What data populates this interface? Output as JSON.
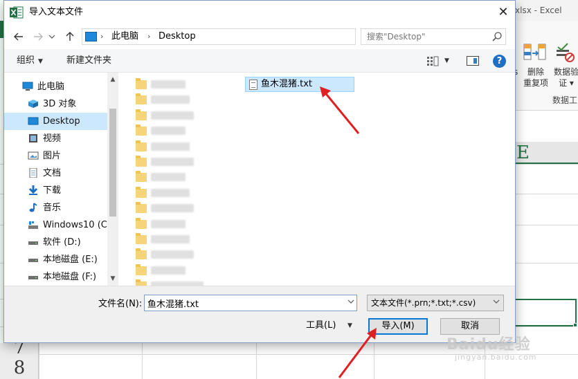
{
  "excel": {
    "title_fragment": "xlsx - Excel",
    "ribbon": {
      "remove_duplicates_line1": "删除",
      "remove_duplicates_line2": "重复项",
      "data_validation_line1": "数据验",
      "data_validation_line2": "证 ▾",
      "group_label": "数据工",
      "partial_label": "s"
    },
    "column_header": "E",
    "row_numbers": [
      "7",
      "8"
    ],
    "colors": {
      "accent": "#217346"
    }
  },
  "dialog": {
    "title": "导入文本文件",
    "close_glyph": "✕",
    "address": {
      "crumbs": [
        "此电脑",
        "Desktop"
      ],
      "separator": "›"
    },
    "search": {
      "placeholder": "搜索\"Desktop\""
    },
    "toolbar": {
      "organize_label": "组织",
      "new_folder_label": "新建文件夹",
      "help_glyph": "?"
    },
    "nav_items": [
      {
        "label": "此电脑",
        "icon": "computer-icon"
      },
      {
        "label": "3D 对象",
        "icon": "3d-objects-icon"
      },
      {
        "label": "Desktop",
        "icon": "desktop-icon",
        "selected": true
      },
      {
        "label": "视频",
        "icon": "video-icon"
      },
      {
        "label": "图片",
        "icon": "pictures-icon"
      },
      {
        "label": "文档",
        "icon": "documents-icon"
      },
      {
        "label": "下载",
        "icon": "download-icon"
      },
      {
        "label": "音乐",
        "icon": "music-icon"
      },
      {
        "label": "Windows10 (C:",
        "icon": "windows-drive-icon"
      },
      {
        "label": "软件 (D:)",
        "icon": "drive-icon"
      },
      {
        "label": "本地磁盘 (E:)",
        "icon": "drive-icon"
      },
      {
        "label": "本地磁盘 (F:)",
        "icon": "drive-icon"
      }
    ],
    "files": {
      "selected_file": "鱼木混猪.txt",
      "blurred_folder_count": 14
    },
    "bottom": {
      "filename_label": "文件名(N):",
      "filename_value": "鱼木混猪.txt",
      "filetype_value": "文本文件(*.prn;*.txt;*.csv)",
      "tools_label": "工具(L)",
      "import_label": "导入(M)",
      "cancel_label": "取消"
    }
  },
  "watermark": {
    "main": "Baidu经验",
    "sub": "jingyan.baidu.com"
  },
  "annotation_color": "#e02020"
}
